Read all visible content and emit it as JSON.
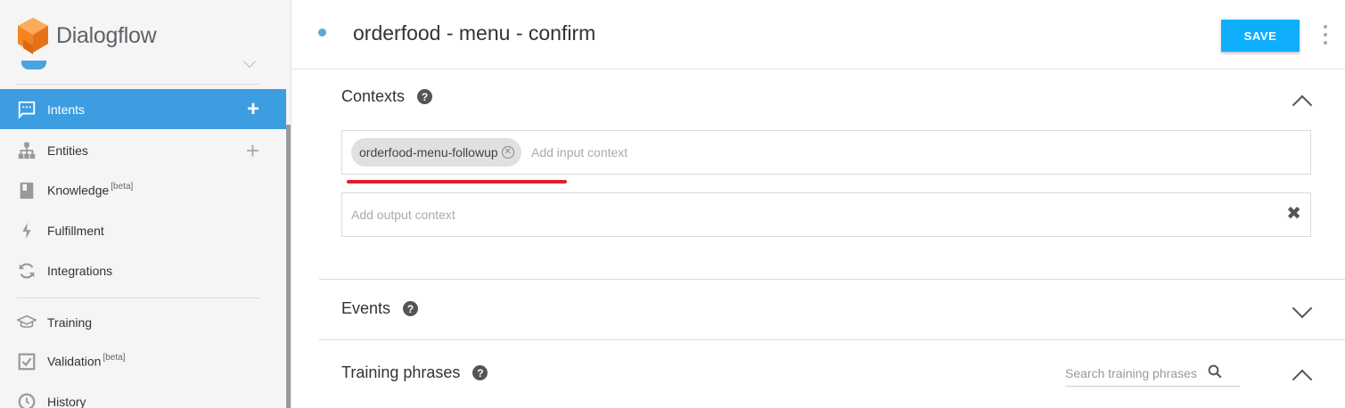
{
  "app": {
    "name": "Dialogflow"
  },
  "sidebar": {
    "items": [
      {
        "label": "Intents",
        "beta": "",
        "active": true,
        "has_add": true
      },
      {
        "label": "Entities",
        "beta": "",
        "active": false,
        "has_add": true
      },
      {
        "label": "Knowledge",
        "beta": "[beta]",
        "active": false
      },
      {
        "label": "Fulfillment",
        "beta": "",
        "active": false
      },
      {
        "label": "Integrations",
        "beta": "",
        "active": false
      },
      {
        "label": "Training",
        "beta": "",
        "active": false
      },
      {
        "label": "Validation",
        "beta": "[beta]",
        "active": false
      },
      {
        "label": "History",
        "beta": "",
        "active": false
      }
    ],
    "add_symbol": "+"
  },
  "header": {
    "title": "orderfood - menu - confirm",
    "save_label": "SAVE"
  },
  "contexts": {
    "title": "Contexts",
    "help": "?",
    "input_chip": "orderfood-menu-followup",
    "input_placeholder": "Add input context",
    "output_placeholder": "Add output context",
    "clear_symbol": "✖",
    "chip_remove_symbol": "✕"
  },
  "events": {
    "title": "Events",
    "help": "?"
  },
  "training_phrases": {
    "title": "Training phrases",
    "help": "?",
    "search_placeholder": "Search training phrases"
  },
  "colors": {
    "accent": "#3c9ee0",
    "save_button": "#0faefc",
    "annotation_underline": "#e0202e",
    "logo_orange": "#f6851f"
  }
}
